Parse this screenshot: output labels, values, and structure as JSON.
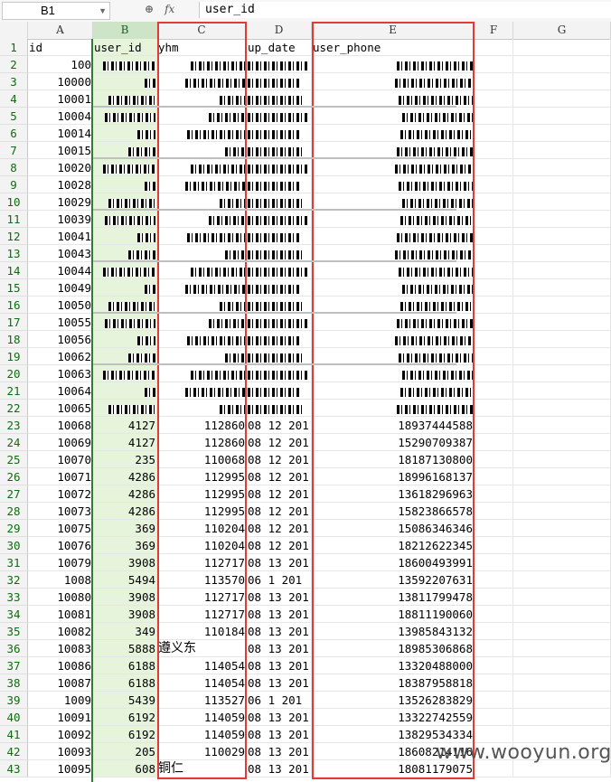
{
  "formula_bar": {
    "name_box": "B1",
    "formula": "user_id",
    "fx_label": "fx"
  },
  "columns": [
    "A",
    "B",
    "C",
    "D",
    "E",
    "F",
    "G"
  ],
  "rows": [
    {
      "n": "1",
      "A": "id",
      "B": "user_id",
      "C": "yhm",
      "D": "up_date",
      "E": "user_phone",
      "header": true
    },
    {
      "n": "2",
      "A": "100",
      "red": true
    },
    {
      "n": "3",
      "A": "10000",
      "red": true
    },
    {
      "n": "4",
      "A": "10001",
      "red": true
    },
    {
      "n": "5",
      "A": "10004",
      "red": true
    },
    {
      "n": "6",
      "A": "10014",
      "red": true
    },
    {
      "n": "7",
      "A": "10015",
      "red": true
    },
    {
      "n": "8",
      "A": "10020",
      "red": true
    },
    {
      "n": "9",
      "A": "10028",
      "red": true
    },
    {
      "n": "10",
      "A": "10029",
      "red": true
    },
    {
      "n": "11",
      "A": "10039",
      "red": true
    },
    {
      "n": "12",
      "A": "10041",
      "red": true
    },
    {
      "n": "13",
      "A": "10043",
      "red": true
    },
    {
      "n": "14",
      "A": "10044",
      "red": true
    },
    {
      "n": "15",
      "A": "10049",
      "red": true
    },
    {
      "n": "16",
      "A": "10050",
      "red": true
    },
    {
      "n": "17",
      "A": "10055",
      "red": true
    },
    {
      "n": "18",
      "A": "10056",
      "red": true
    },
    {
      "n": "19",
      "A": "10062",
      "red": true
    },
    {
      "n": "20",
      "A": "10063",
      "red": true
    },
    {
      "n": "21",
      "A": "10064",
      "red": true
    },
    {
      "n": "22",
      "A": "10065",
      "red": true
    },
    {
      "n": "23",
      "A": "10068",
      "B": "4127",
      "C": "112860",
      "D": "08 12 201",
      "E": "18937444588"
    },
    {
      "n": "24",
      "A": "10069",
      "B": "4127",
      "C": "112860",
      "D": "08 12 201",
      "E": "15290709387"
    },
    {
      "n": "25",
      "A": "10070",
      "B": "235",
      "C": "110068",
      "D": "08 12 201",
      "E": "18187130800"
    },
    {
      "n": "26",
      "A": "10071",
      "B": "4286",
      "C": "112995",
      "D": "08 12 201",
      "E": "18996168137"
    },
    {
      "n": "27",
      "A": "10072",
      "B": "4286",
      "C": "112995",
      "D": "08 12 201",
      "E": "13618296963"
    },
    {
      "n": "28",
      "A": "10073",
      "B": "4286",
      "C": "112995",
      "D": "08 12 201",
      "E": "15823866578"
    },
    {
      "n": "29",
      "A": "10075",
      "B": "369",
      "C": "110204",
      "D": "08 12 201",
      "E": "15086346346"
    },
    {
      "n": "30",
      "A": "10076",
      "B": "369",
      "C": "110204",
      "D": "08 12 201",
      "E": "18212622345"
    },
    {
      "n": "31",
      "A": "10079",
      "B": "3908",
      "C": "112717",
      "D": "08 13 201",
      "E": "18600493991"
    },
    {
      "n": "32",
      "A": "1008",
      "B": "5494",
      "C": "113570",
      "D": "06  1 201",
      "E": "13592207631"
    },
    {
      "n": "33",
      "A": "10080",
      "B": "3908",
      "C": "112717",
      "D": "08 13 201",
      "E": "13811799478"
    },
    {
      "n": "34",
      "A": "10081",
      "B": "3908",
      "C": "112717",
      "D": "08 13 201",
      "E": "18811190060"
    },
    {
      "n": "35",
      "A": "10082",
      "B": "349",
      "C": "110184",
      "D": "08 13 201",
      "E": "13985843132"
    },
    {
      "n": "36",
      "A": "10083",
      "B": "5888",
      "C": "遵义东",
      "D": "08 13 201",
      "E": "18985306868",
      "cn": true
    },
    {
      "n": "37",
      "A": "10086",
      "B": "6188",
      "C": "114054",
      "D": "08 13 201",
      "E": "13320488000"
    },
    {
      "n": "38",
      "A": "10087",
      "B": "6188",
      "C": "114054",
      "D": "08 13 201",
      "E": "18387958818"
    },
    {
      "n": "39",
      "A": "1009",
      "B": "5439",
      "C": "113527",
      "D": "06  1 201",
      "E": "13526283829"
    },
    {
      "n": "40",
      "A": "10091",
      "B": "6192",
      "C": "114059",
      "D": "08 13 201",
      "E": "13322742559"
    },
    {
      "n": "41",
      "A": "10092",
      "B": "6192",
      "C": "114059",
      "D": "08 13 201",
      "E": "13829534334"
    },
    {
      "n": "42",
      "A": "10093",
      "B": "205",
      "C": "110029",
      "D": "08 13 201",
      "E": "18608214116"
    },
    {
      "n": "43",
      "A": "10095",
      "B": "608",
      "C": "铜仁",
      "D": "08 13 201",
      "E": "18081179075",
      "cn": true
    }
  ],
  "watermark": "www.wooyun.org"
}
